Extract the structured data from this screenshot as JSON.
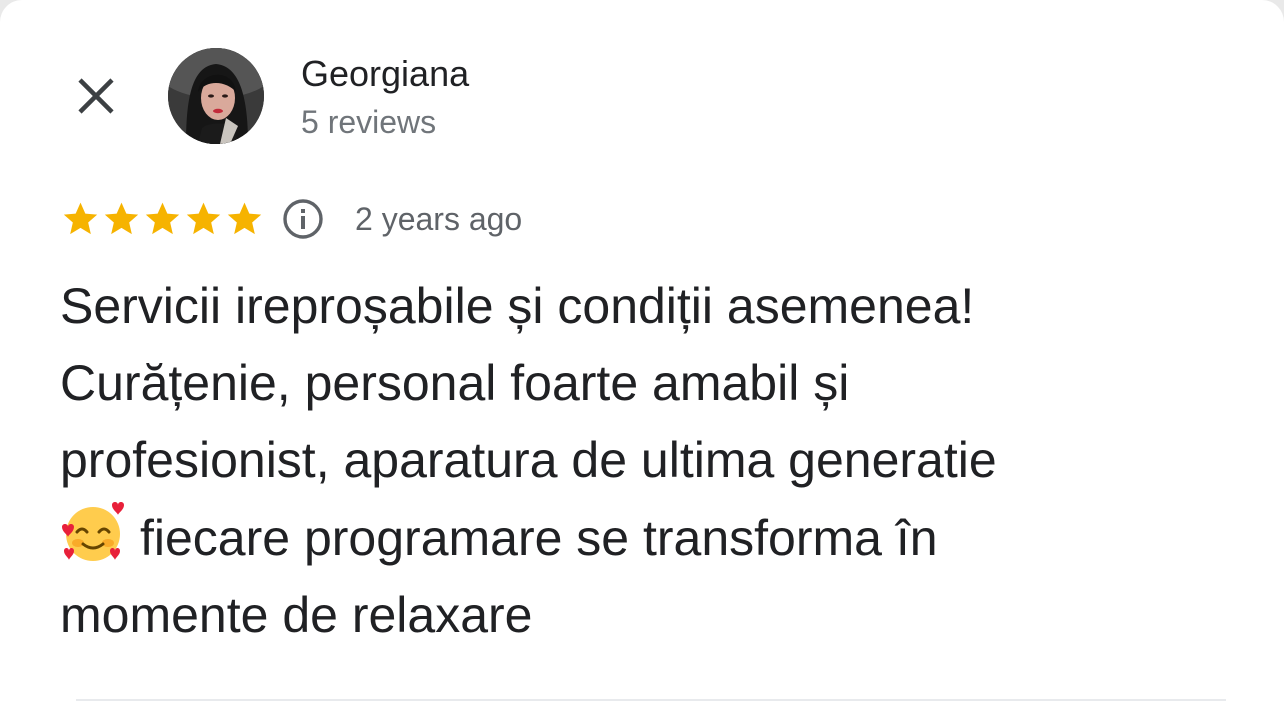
{
  "review_dialog": {
    "close_icon": "close-icon",
    "author": {
      "name": "Georgiana",
      "reviews_count": "5 reviews",
      "avatar": "avatar-photo"
    },
    "rating": {
      "stars": 5,
      "max_stars": 5,
      "star_color": "#f6b300",
      "info_icon": "info-circle-icon",
      "time_ago": "2 years ago"
    },
    "review": {
      "lines": [
        "Servicii ireproșabile și condiții asemenea!",
        "Curățenie, personal foarte amabil și",
        "profesionist, aparatura de ultima generatie",
        "fiecare programare se transforma în",
        "momente de relaxare"
      ],
      "emoji": "smiling-face-with-hearts-emoji"
    }
  }
}
